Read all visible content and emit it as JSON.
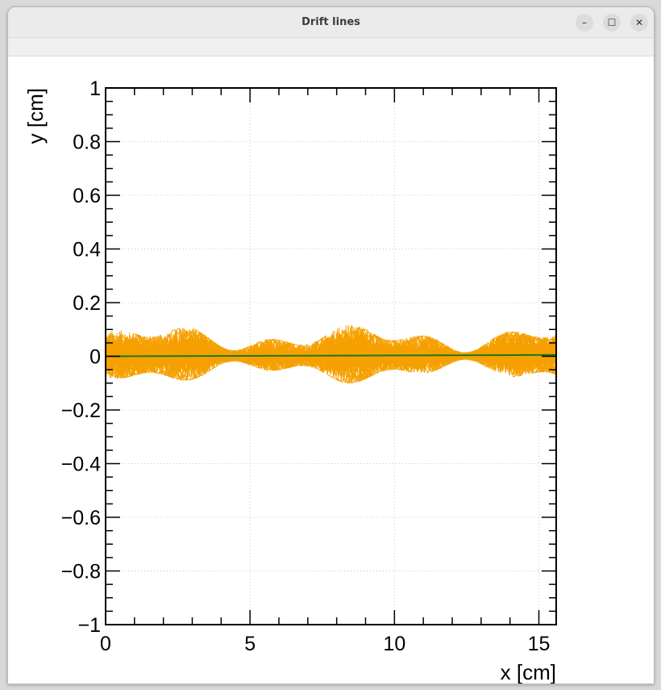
{
  "window": {
    "title": "Drift lines",
    "minimize_symbol": "–",
    "maximize_symbol": "☐",
    "close_symbol": "✕"
  },
  "chart_data": {
    "type": "line",
    "title": "",
    "xlabel": "x [cm]",
    "ylabel": "y [cm]",
    "xlim": [
      0,
      15.6
    ],
    "ylim": [
      -1,
      1
    ],
    "grid": true,
    "x_ticks": [
      0,
      5,
      10,
      15
    ],
    "x_tick_labels": [
      "0",
      "5",
      "10",
      "15"
    ],
    "y_ticks": [
      -1,
      -0.8,
      -0.6,
      -0.4,
      -0.2,
      0,
      0.2,
      0.4,
      0.6,
      0.8,
      1
    ],
    "y_tick_labels": [
      "−1",
      "−0.8",
      "−0.6",
      "−0.4",
      "−0.2",
      "0",
      "0.2",
      "0.4",
      "0.6",
      "0.8",
      "1"
    ],
    "series": [
      {
        "color": "#f5a000",
        "description_of_shape": "many noisy drift paths",
        "x_range": [
          0,
          15.6
        ],
        "y_band": [
          -0.1,
          0.12
        ]
      },
      {
        "color": "#1a7a1a",
        "x": [
          0,
          15.6
        ],
        "y": [
          0,
          0.005
        ]
      }
    ],
    "colors": {
      "drift": "#f5a000",
      "track": "#1a7a1a"
    }
  }
}
